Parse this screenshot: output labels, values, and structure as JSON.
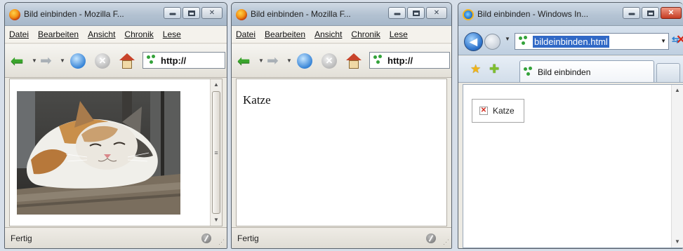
{
  "colors": {
    "firefox_frame": "#eceae3",
    "ie_frame": "#d2deea",
    "selection": "#3169c6"
  },
  "firefox_window_1": {
    "title": "Bild einbinden - Mozilla F...",
    "menu": [
      "Datei",
      "Bearbeiten",
      "Ansicht",
      "Chronik",
      "Lese"
    ],
    "url_text": "http://",
    "content_image": "cat-photo",
    "status": "Fertig"
  },
  "firefox_window_2": {
    "title": "Bild einbinden - Mozilla F...",
    "menu": [
      "Datei",
      "Bearbeiten",
      "Ansicht",
      "Chronik",
      "Lese"
    ],
    "url_text": "http://",
    "alt_text": "Katze",
    "status": "Fertig"
  },
  "ie_window": {
    "title": "Bild einbinden - Windows In...",
    "address": "bildeinbinden.html",
    "tab_label": "Bild einbinden",
    "alt_text": "Katze"
  },
  "icons": [
    "firefox-icon",
    "ie-icon",
    "back-icon",
    "forward-icon",
    "reload-icon",
    "stop-icon",
    "home-icon",
    "favorites-star-icon",
    "add-favorite-icon",
    "broken-image-icon"
  ]
}
